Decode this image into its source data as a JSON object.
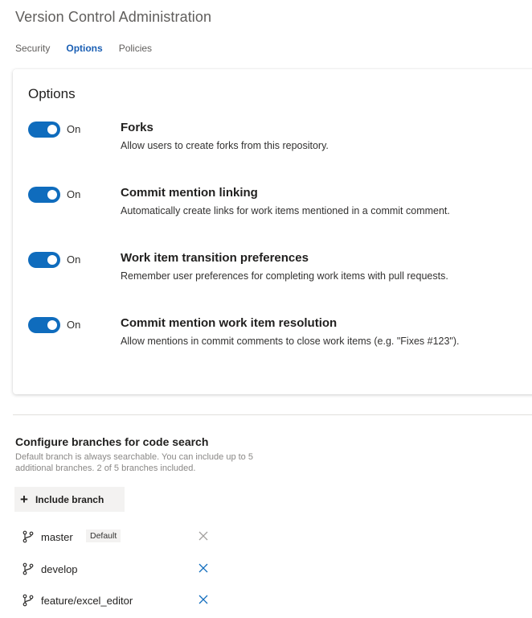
{
  "header": {
    "title": "Version Control Administration"
  },
  "tabs": [
    {
      "label": "Security",
      "active": false
    },
    {
      "label": "Options",
      "active": true
    },
    {
      "label": "Policies",
      "active": false
    }
  ],
  "options_card": {
    "title": "Options",
    "items": [
      {
        "state": "On",
        "title": "Forks",
        "description": "Allow users to create forks from this repository."
      },
      {
        "state": "On",
        "title": "Commit mention linking",
        "description": "Automatically create links for work items mentioned in a commit comment."
      },
      {
        "state": "On",
        "title": "Work item transition preferences",
        "description": "Remember user preferences for completing work items with pull requests."
      },
      {
        "state": "On",
        "title": "Commit mention work item resolution",
        "description": "Allow mentions in commit comments to close work items (e.g. \"Fixes #123\")."
      }
    ]
  },
  "code_search": {
    "title": "Configure branches for code search",
    "description": "Default branch is always searchable. You can include up to 5 additional branches. 2 of 5 branches included.",
    "include_button": "Include branch",
    "branches": [
      {
        "name": "master",
        "badge": "Default",
        "removable": false
      },
      {
        "name": "develop",
        "removable": true
      },
      {
        "name": "feature/excel_editor",
        "removable": true
      }
    ]
  },
  "colors": {
    "accent": "#0f6cbd",
    "tab_active": "#1a5fb4",
    "remove_enabled": "#0f6cbd",
    "remove_disabled": "#a19f9d"
  },
  "icons": {
    "branch": "branch-icon",
    "remove": "close-icon",
    "add": "plus-icon"
  }
}
